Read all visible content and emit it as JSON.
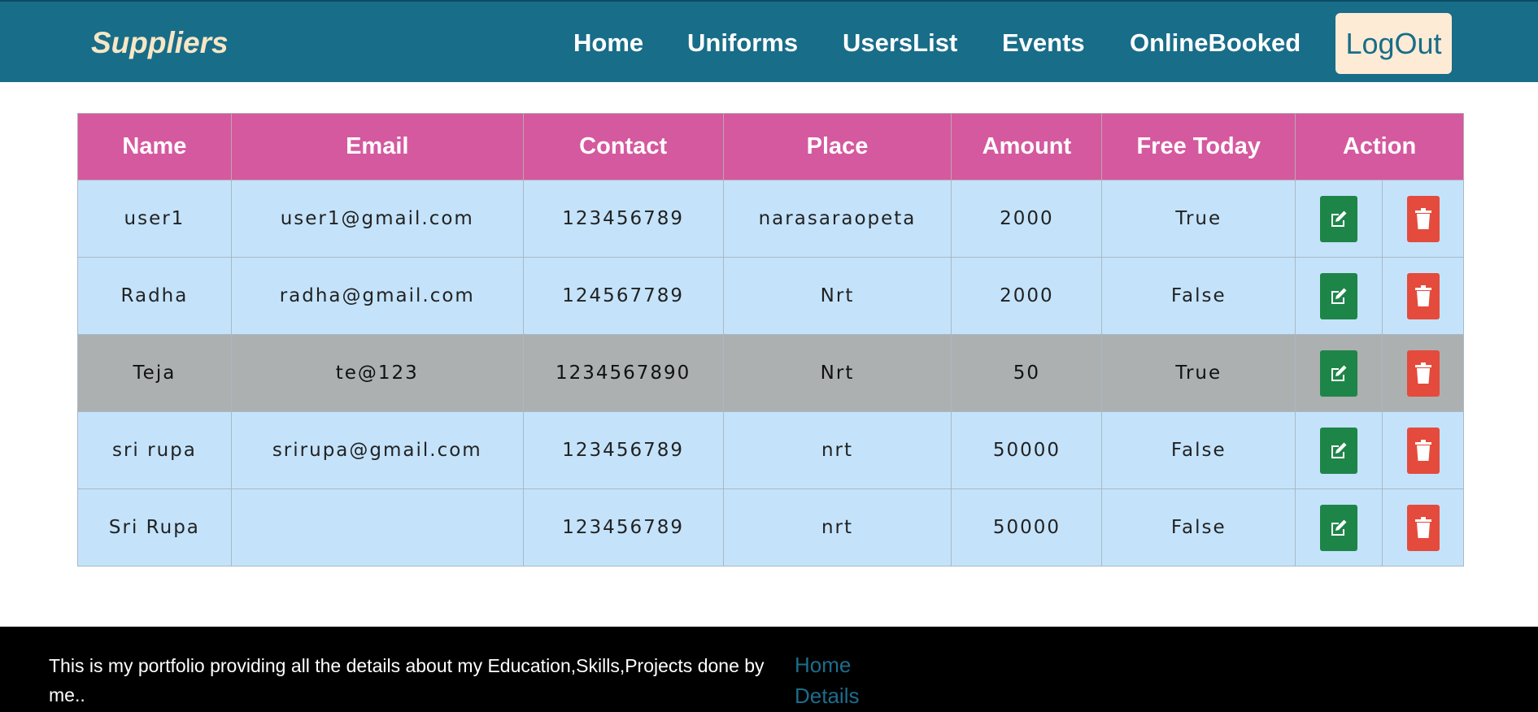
{
  "navbar": {
    "brand": "Suppliers",
    "links": [
      "Home",
      "Uniforms",
      "UsersList",
      "Events",
      "OnlineBooked"
    ],
    "logout": "LogOut"
  },
  "table": {
    "headers": [
      "Name",
      "Email",
      "Contact",
      "Place",
      "Amount",
      "Free Today",
      "Action"
    ],
    "rows": [
      {
        "name": "user1",
        "email": "user1@gmail.com",
        "contact": "123456789",
        "place": "narasaraopeta",
        "amount": "2000",
        "free_today": "True"
      },
      {
        "name": "Radha",
        "email": "radha@gmail.com",
        "contact": "124567789",
        "place": "Nrt",
        "amount": "2000",
        "free_today": "False"
      },
      {
        "name": "Teja",
        "email": "te@123",
        "contact": "1234567890",
        "place": "Nrt",
        "amount": "50",
        "free_today": "True"
      },
      {
        "name": "sri rupa",
        "email": "srirupa@gmail.com",
        "contact": "123456789",
        "place": "nrt",
        "amount": "50000",
        "free_today": "False"
      },
      {
        "name": "Sri Rupa",
        "email": "",
        "contact": "123456789",
        "place": "nrt",
        "amount": "50000",
        "free_today": "False"
      }
    ],
    "action_icons": [
      "edit-icon",
      "trash-icon"
    ],
    "highlighted_row": 2
  },
  "footer": {
    "text": "This is my portfolio providing all the details about my Education,Skills,Projects done by me..",
    "links": [
      "Home",
      "Details"
    ]
  },
  "colors": {
    "navbar": "#186d89",
    "brand": "#f7e7c5",
    "header": "#d5599f",
    "row": "#c4e3fb",
    "row_highlight": "#adb0b1",
    "edit_button": "#1e8548",
    "delete_button": "#e44b3c",
    "footer": "#000000",
    "footer_link": "#1c6d8c"
  }
}
